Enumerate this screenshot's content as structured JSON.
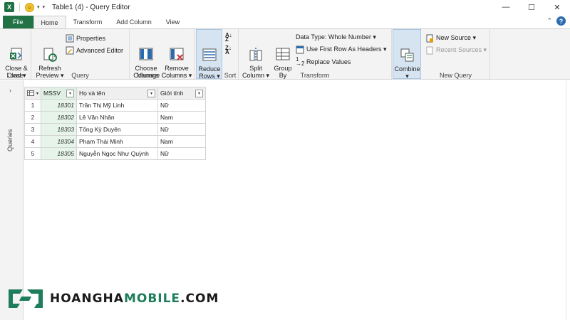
{
  "window": {
    "title": "Table1 (4) - Query Editor",
    "controls": {
      "minimize": "—",
      "maximize": "☐",
      "close": "✕"
    }
  },
  "tabs": [
    {
      "label": "File"
    },
    {
      "label": "Home"
    },
    {
      "label": "Transform"
    },
    {
      "label": "Add Column"
    },
    {
      "label": "View"
    }
  ],
  "ribbon": {
    "close_group": {
      "label": "Close",
      "close_load": "Close &\nLoad ▾"
    },
    "query_group": {
      "label": "Query",
      "refresh": "Refresh\nPreview ▾",
      "properties": "Properties",
      "advanced_editor": "Advanced Editor"
    },
    "manage_columns_group": {
      "label": "Manage Columns",
      "choose_columns": "Choose\nColumns",
      "remove_columns": "Remove\nColumns ▾"
    },
    "reduce_group": {
      "reduce_rows": "Reduce\nRows ▾"
    },
    "sort_group": {
      "label": "Sort"
    },
    "transform_group": {
      "label": "Transform",
      "split_column": "Split\nColumn ▾",
      "group_by": "Group\nBy",
      "data_type": "Data Type: Whole Number ▾",
      "first_row_headers": "Use First Row As Headers ▾",
      "replace_values": "Replace Values"
    },
    "combine_group": {
      "combine": "Combine\n▾"
    },
    "new_query_group": {
      "label": "New Query",
      "new_source": "New Source ▾",
      "recent_sources": "Recent Sources ▾"
    }
  },
  "queries_pane": {
    "label": "Queries"
  },
  "table": {
    "columns": [
      "MSSV",
      "Họ và tên",
      "Giới tính"
    ],
    "rows": [
      {
        "num": "1",
        "mssv": "18301",
        "name": "Trần Thị Mỹ Linh",
        "gender": "Nữ"
      },
      {
        "num": "2",
        "mssv": "18302",
        "name": "Lê Văn Nhân",
        "gender": "Nam"
      },
      {
        "num": "3",
        "mssv": "18303",
        "name": "Tống Kỳ Duyên",
        "gender": "Nữ"
      },
      {
        "num": "4",
        "mssv": "18304",
        "name": "Phạm Thái Minh",
        "gender": "Nam"
      },
      {
        "num": "5",
        "mssv": "18305",
        "name": "Nguyễn Ngọc Như Quỳnh",
        "gender": "Nữ"
      }
    ]
  },
  "watermark": {
    "part1": "HOANGHA",
    "part2": "MOBILE",
    "part3": ".COM"
  },
  "colors": {
    "excel_green": "#217346",
    "mssv_bg": "#e6f4ea",
    "ribbon_bg": "#f3f3f3"
  }
}
